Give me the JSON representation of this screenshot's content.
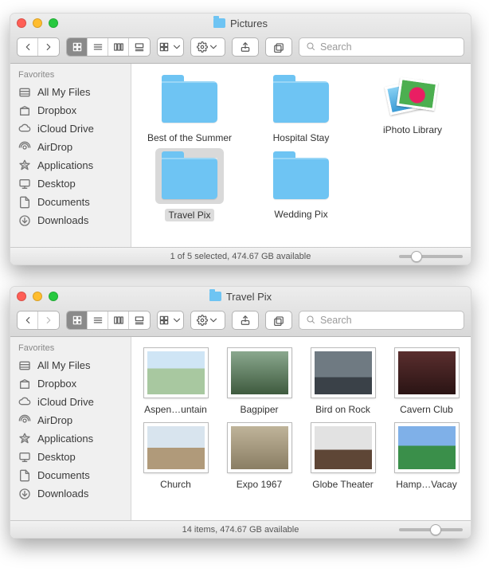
{
  "windows": [
    {
      "title": "Pictures",
      "search_placeholder": "Search",
      "sidebar": {
        "header": "Favorites",
        "items": [
          {
            "label": "All My Files",
            "icon": "all-my-files"
          },
          {
            "label": "Dropbox",
            "icon": "dropbox"
          },
          {
            "label": "iCloud Drive",
            "icon": "icloud"
          },
          {
            "label": "AirDrop",
            "icon": "airdrop"
          },
          {
            "label": "Applications",
            "icon": "applications"
          },
          {
            "label": "Desktop",
            "icon": "desktop"
          },
          {
            "label": "Documents",
            "icon": "documents"
          },
          {
            "label": "Downloads",
            "icon": "downloads"
          }
        ]
      },
      "items": [
        {
          "type": "folder",
          "label": "Best of the Summer",
          "selected": false
        },
        {
          "type": "folder",
          "label": "Hospital Stay",
          "selected": false
        },
        {
          "type": "iphoto",
          "label": "iPhoto Library",
          "selected": false
        },
        {
          "type": "folder",
          "label": "Travel Pix",
          "selected": true
        },
        {
          "type": "folder",
          "label": "Wedding Pix",
          "selected": false
        }
      ],
      "status": "1 of 5 selected, 474.67 GB available",
      "slider_pos": 0.28
    },
    {
      "title": "Travel Pix",
      "search_placeholder": "Search",
      "sidebar": {
        "header": "Favorites",
        "items": [
          {
            "label": "All My Files",
            "icon": "all-my-files"
          },
          {
            "label": "Dropbox",
            "icon": "dropbox"
          },
          {
            "label": "iCloud Drive",
            "icon": "icloud"
          },
          {
            "label": "AirDrop",
            "icon": "airdrop"
          },
          {
            "label": "Applications",
            "icon": "applications"
          },
          {
            "label": "Desktop",
            "icon": "desktop"
          },
          {
            "label": "Documents",
            "icon": "documents"
          },
          {
            "label": "Downloads",
            "icon": "downloads"
          }
        ]
      },
      "items": [
        {
          "type": "image",
          "label": "Aspen…untain",
          "bg": "linear-gradient(#cfe5f5 40%,#a8c8a0 40% 100%)"
        },
        {
          "type": "image",
          "label": "Bagpiper",
          "bg": "linear-gradient(#8aa88e,#3e5a3e)"
        },
        {
          "type": "image",
          "label": "Bird on Rock",
          "bg": "linear-gradient(#6f7a82 60%,#3a4148 60%)"
        },
        {
          "type": "image",
          "label": "Cavern Club",
          "bg": "linear-gradient(#5a2e2e,#2a1414)"
        },
        {
          "type": "image",
          "label": "Church",
          "bg": "linear-gradient(#d8e4ee 50%,#b09a7a 50%)"
        },
        {
          "type": "image",
          "label": "Expo 1967",
          "bg": "linear-gradient(#bfb49a,#8a7e64)"
        },
        {
          "type": "image",
          "label": "Globe Theater",
          "bg": "linear-gradient(#e2e2e2 55%,#5e4636 55%)"
        },
        {
          "type": "image",
          "label": "Hamp…Vacay",
          "bg": "linear-gradient(#7fb0e8 45%,#3a8f4a 45%)"
        }
      ],
      "status": "14 items, 474.67 GB available",
      "slider_pos": 0.58
    }
  ]
}
